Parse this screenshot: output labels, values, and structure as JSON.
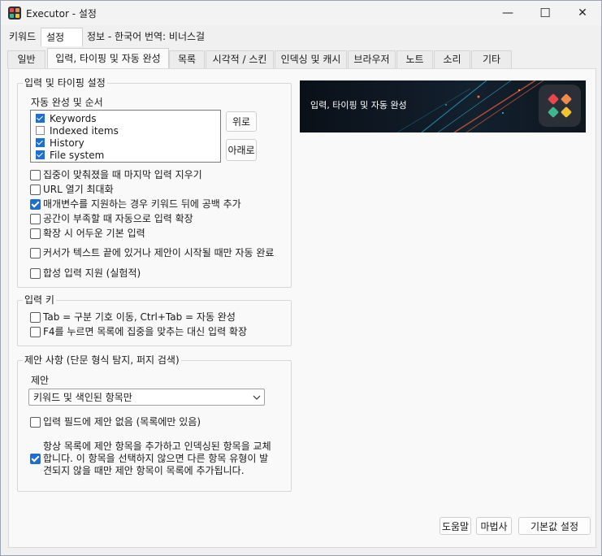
{
  "window": {
    "title": "Executor - 설정",
    "minimize_glyph": "—",
    "maximize_glyph": "☐",
    "close_glyph": "✕"
  },
  "main_tabs": [
    {
      "label": "키워드"
    },
    {
      "label": "설정"
    },
    {
      "label": "정보 - 한국어 번역: 비너스걸"
    }
  ],
  "sub_tabs": [
    {
      "label": "일반"
    },
    {
      "label": "입력, 타이핑 및 자동 완성"
    },
    {
      "label": "목록"
    },
    {
      "label": "시각적 / 스킨"
    },
    {
      "label": "인덱싱 및 캐시"
    },
    {
      "label": "브라우저"
    },
    {
      "label": "노트"
    },
    {
      "label": "소리"
    },
    {
      "label": "기타"
    }
  ],
  "banner": {
    "text": "입력, 타이핑 및 자동 완성"
  },
  "input_group": {
    "legend": "입력 및 타이핑 설정",
    "autocomplete_label": "자동 완성 및 순서",
    "list_items": [
      {
        "label": "Keywords",
        "checked": true
      },
      {
        "label": "Indexed items",
        "checked": false
      },
      {
        "label": "History",
        "checked": true
      },
      {
        "label": "File system",
        "checked": true
      }
    ],
    "up_button": "위로",
    "down_button": "아래로",
    "options": [
      {
        "label": "집중이 맞춰졌을 때 마지막 입력 지우기",
        "checked": false
      },
      {
        "label": "URL 열기 최대화",
        "checked": false
      },
      {
        "label": "매개변수를 지원하는 경우 키워드 뒤에 공백 추가",
        "checked": true
      },
      {
        "label": "공간이 부족할 때 자동으로 입력 확장",
        "checked": false
      },
      {
        "label": "확장 시 어두운 기본 입력",
        "checked": false
      },
      {
        "label": "커서가 텍스트 끝에 있거나 제안이 시작될 때만 자동 완료",
        "checked": false
      },
      {
        "label": "합성 입력 지원 (실험적)",
        "checked": false
      }
    ]
  },
  "keys_group": {
    "legend": "입력 키",
    "options": [
      {
        "label": "Tab = 구분 기호 이동, Ctrl+Tab = 자동 완성",
        "checked": false
      },
      {
        "label": "F4를 누르면 목록에 집중을 맞추는 대신 입력 확장",
        "checked": false
      }
    ]
  },
  "suggest_group": {
    "legend": "제안 사항 (단문 형식 탐지, 퍼지 검색)",
    "suggest_label": "제안",
    "select_value": "키워드 및 색인된 항목만",
    "no_suggest_option": {
      "label": "입력 필드에 제안 없음 (목록에만 있음)",
      "checked": false
    },
    "always_add_option": {
      "checked": true,
      "lines": [
        "항상 목록에 제안 항목을 추가하고 인덱싱된 항목을 교체",
        "합니다. 이 항목을 선택하지 않으면 다른 항목 유형이 발",
        "견되지 않을 때만 제안 항목이 목록에 추가됩니다."
      ]
    }
  },
  "footer": {
    "help": "도움말",
    "wizard": "마법사",
    "defaults": "기본값 설정"
  },
  "colors": {
    "accent": "#1f6fd0",
    "icon_red": "#e8484c",
    "icon_green": "#3fb68b",
    "icon_yellow": "#f2c230",
    "icon_orange": "#f08a4b"
  }
}
